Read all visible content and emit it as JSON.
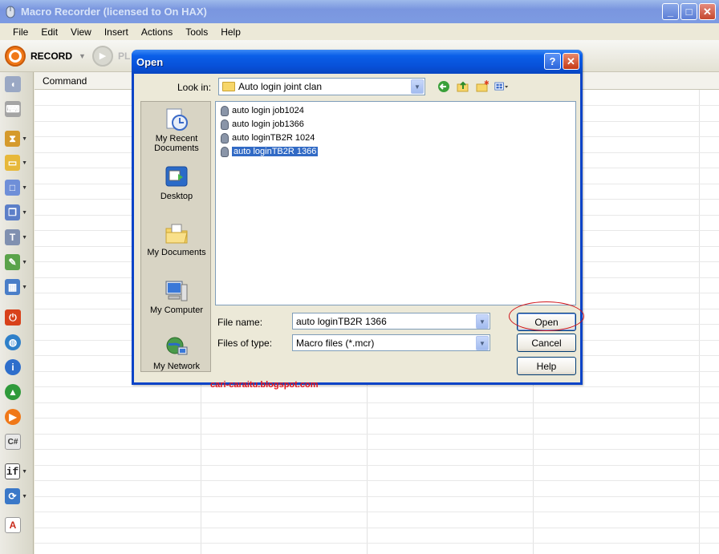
{
  "app": {
    "title": "Macro Recorder (licensed to On HAX)"
  },
  "menu": [
    "File",
    "Edit",
    "View",
    "Insert",
    "Actions",
    "Tools",
    "Help"
  ],
  "toolbar": {
    "record_label": "RECORD",
    "play_label": "PL"
  },
  "grid": {
    "column_header": "Command"
  },
  "left_tools": [
    {
      "icon": "mouse-icon",
      "color": "#9aa8c4"
    },
    {
      "icon": "keyboard-icon",
      "color": "#a4a4a4"
    },
    {
      "icon": "hourglass-icon",
      "color": "#d59a2c"
    },
    {
      "icon": "window-icon",
      "color": "#e7b83a"
    },
    {
      "icon": "window-frame-icon",
      "color": "#6f8fd8"
    },
    {
      "icon": "clipboard-icon",
      "color": "#5c7fc8"
    },
    {
      "icon": "text-icon",
      "color": "#8090b0"
    },
    {
      "icon": "eyedropper-icon",
      "color": "#5aa34a"
    },
    {
      "icon": "image-icon",
      "color": "#4a7ec8"
    },
    {
      "icon": "stop-icon",
      "color": "#d8411a"
    },
    {
      "icon": "globe-icon",
      "color": "#2f80c9"
    },
    {
      "icon": "info-icon",
      "color": "#2e6ecb"
    },
    {
      "icon": "download-globe-icon",
      "color": "#2f9a3a"
    },
    {
      "icon": "play-macro-icon",
      "color": "#f07818"
    },
    {
      "icon": "csharp-icon",
      "color": "#7a8aa8"
    },
    {
      "icon": "if-icon",
      "color": "#5a6a8a"
    },
    {
      "icon": "loop-icon",
      "color": "#3a78c8"
    },
    {
      "icon": "text-a-icon",
      "color": "#c82a1a"
    }
  ],
  "dialog": {
    "title": "Open",
    "look_in_label": "Look in:",
    "look_in_value": "Auto login joint clan",
    "places": [
      "My Recent Documents",
      "Desktop",
      "My Documents",
      "My Computer",
      "My Network"
    ],
    "files": [
      {
        "name": "auto login job1024",
        "selected": false
      },
      {
        "name": "auto login job1366",
        "selected": false
      },
      {
        "name": "auto loginTB2R 1024",
        "selected": false
      },
      {
        "name": "auto loginTB2R 1366",
        "selected": true
      }
    ],
    "file_name_label": "File name:",
    "file_name_value": "auto loginTB2R 1366",
    "file_type_label": "Files of type:",
    "file_type_value": "Macro files (*.mcr)",
    "open_button": "Open",
    "cancel_button": "Cancel",
    "help_button": "Help"
  },
  "watermark": "cari-caraitu.blogspot.com"
}
